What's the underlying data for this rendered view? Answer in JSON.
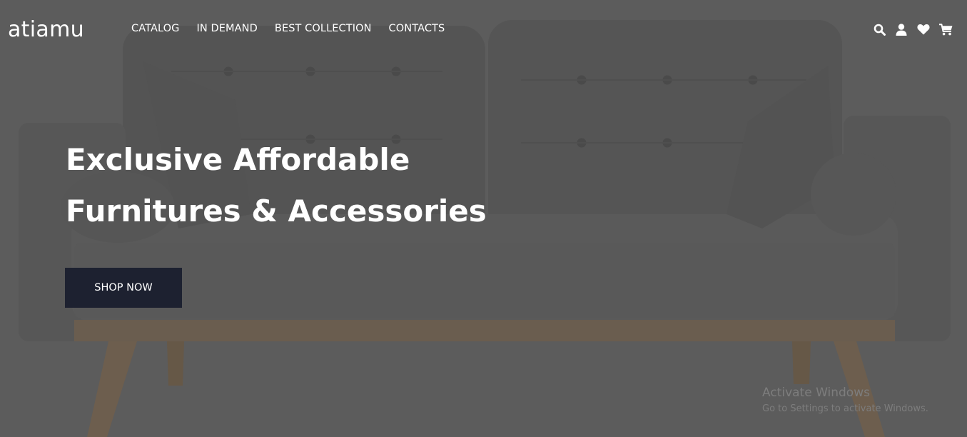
{
  "brand": {
    "logo_text": "atiamu"
  },
  "nav": {
    "links": [
      {
        "label": "CATALOG"
      },
      {
        "label": "IN DEMAND"
      },
      {
        "label": "BEST COLLECTION"
      },
      {
        "label": "CONTACTS"
      }
    ],
    "icons": [
      "search-icon",
      "user-icon",
      "heart-icon",
      "cart-icon"
    ]
  },
  "hero": {
    "headline_line1": "Exclusive Affordable",
    "headline_line2": "Furnitures & Accessories",
    "cta_label": "SHOP NOW",
    "image": "gray-tufted-sofa"
  },
  "os_watermark": {
    "title": "Activate Windows",
    "subtitle": "Go to Settings to activate Windows."
  },
  "colors": {
    "background_overlay": "#5c5c5c",
    "cta_background": "#1d2130",
    "text": "#ffffff"
  }
}
